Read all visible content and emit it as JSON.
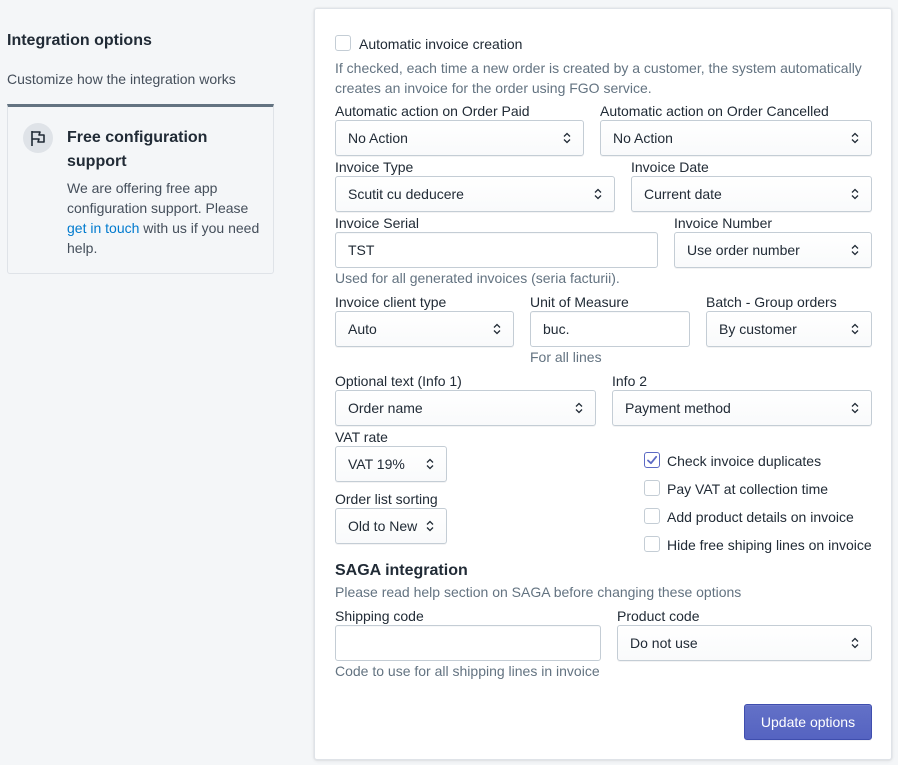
{
  "left": {
    "title": "Integration options",
    "description": "Customize how the integration works",
    "help_card": {
      "icon": "flag-icon",
      "title": "Free configuration support",
      "body_prefix": "We are offering free app configuration support. Please ",
      "link": "get in touch",
      "body_suffix": " with us if you need help."
    }
  },
  "form": {
    "auto_invoice": {
      "label": "Automatic invoice creation",
      "checked": false,
      "help": "If checked, each time a new order is created by a customer, the system automatically creates an invoice for the order using FGO service."
    },
    "order_paid": {
      "label": "Automatic action on Order Paid",
      "value": "No Action"
    },
    "order_cancelled": {
      "label": "Automatic action on Order Cancelled",
      "value": "No Action"
    },
    "invoice_type": {
      "label": "Invoice Type",
      "value": "Scutit cu deducere"
    },
    "invoice_date": {
      "label": "Invoice Date",
      "value": "Current date"
    },
    "invoice_serial": {
      "label": "Invoice Serial",
      "value": "TST",
      "help": "Used for all generated invoices (seria facturii)."
    },
    "invoice_number": {
      "label": "Invoice Number",
      "value": "Use order number"
    },
    "client_type": {
      "label": "Invoice client type",
      "value": "Auto"
    },
    "unit_measure": {
      "label": "Unit of Measure",
      "value": "buc.",
      "help": "For all lines"
    },
    "batch_group": {
      "label": "Batch - Group orders",
      "value": "By customer"
    },
    "info1": {
      "label": "Optional text (Info 1)",
      "value": "Order name"
    },
    "info2": {
      "label": "Info 2",
      "value": "Payment method"
    },
    "vat_rate": {
      "label": "VAT rate",
      "value": "VAT 19%"
    },
    "sorting": {
      "label": "Order list sorting",
      "value": "Old to New"
    },
    "checks": [
      {
        "label": "Check invoice duplicates",
        "checked": true
      },
      {
        "label": "Pay VAT at collection time",
        "checked": false
      },
      {
        "label": "Add product details on invoice",
        "checked": false
      },
      {
        "label": "Hide free shiping lines on invoice",
        "checked": false
      }
    ],
    "saga": {
      "title": "SAGA integration",
      "help": "Please read help section on SAGA before changing these options",
      "shipping_code": {
        "label": "Shipping code",
        "value": "",
        "help": "Code to use for all shipping lines in invoice"
      },
      "product_code": {
        "label": "Product code",
        "value": "Do not use"
      }
    },
    "submit_label": "Update options"
  },
  "colors": {
    "accent": "#5c6ac4",
    "link": "#007ace",
    "muted_text": "#637381",
    "background": "#f4f6f8"
  }
}
